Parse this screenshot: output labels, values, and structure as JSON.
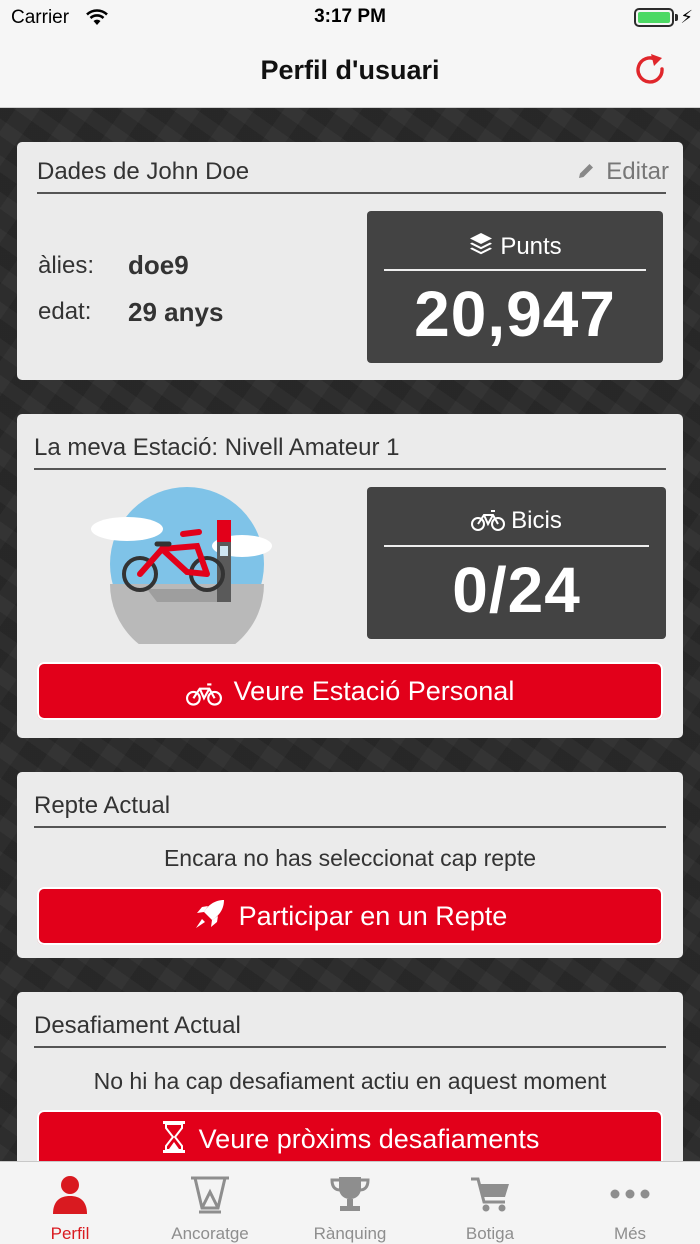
{
  "status_bar": {
    "carrier": "Carrier",
    "time": "3:17 PM"
  },
  "nav": {
    "title": "Perfil d'usuari"
  },
  "profile_card": {
    "title": "Dades de John Doe",
    "edit_label": "Editar",
    "alias_label": "àlies:",
    "alias_value": "doe9",
    "age_label": "edat:",
    "age_value": "29 anys",
    "points_label": "Punts",
    "points_value": "20,947"
  },
  "station_card": {
    "title": "La meva Estació: Nivell Amateur 1",
    "bikes_label": "Bicis",
    "bikes_value": "0/24",
    "button_label": "Veure Estació Personal"
  },
  "challenge_card": {
    "title": "Repte Actual",
    "empty_text": "Encara no has seleccionat cap repte",
    "button_label": "Participar en un Repte"
  },
  "dare_card": {
    "title": "Desafiament Actual",
    "empty_text": "No hi ha cap desafiament actiu en aquest moment",
    "button_label": "Veure pròxims desafiaments"
  },
  "tabs": [
    {
      "label": "Perfil",
      "icon": "user-icon",
      "active": true
    },
    {
      "label": "Ancoratge",
      "icon": "dock-icon",
      "active": false
    },
    {
      "label": "Rànquing",
      "icon": "trophy-icon",
      "active": false
    },
    {
      "label": "Botiga",
      "icon": "cart-icon",
      "active": false
    },
    {
      "label": "Més",
      "icon": "more-icon",
      "active": false
    }
  ],
  "colors": {
    "accent": "#e2001a",
    "tab_active": "#d91a20",
    "stat_box": "#434343",
    "card": "#ebebeb"
  }
}
